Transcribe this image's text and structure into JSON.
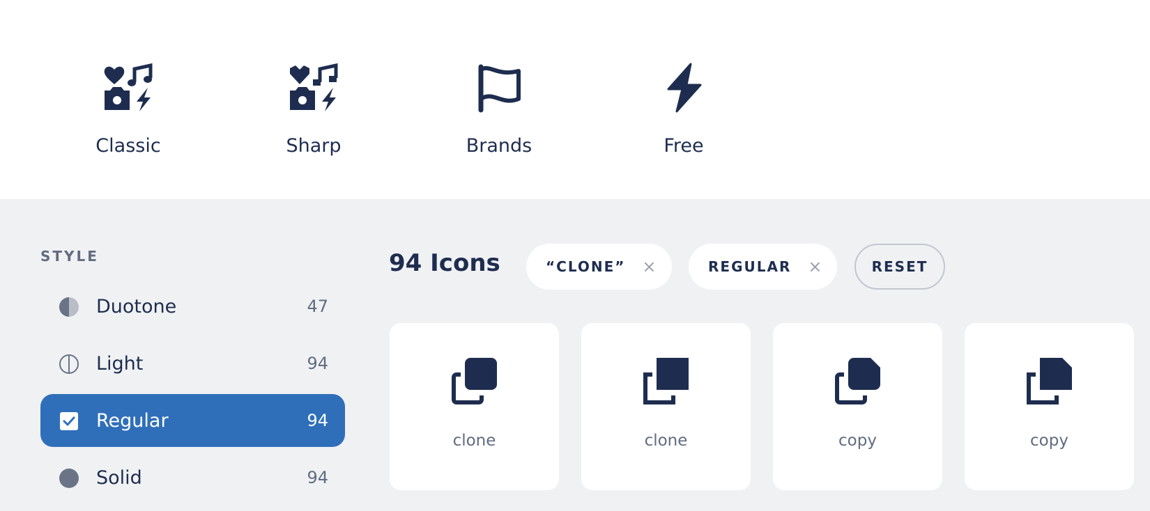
{
  "families": [
    {
      "label": "Classic",
      "icon": "heart-music-camera-bolt-icon"
    },
    {
      "label": "Sharp",
      "icon": "heart-music-camera-bolt-icon"
    },
    {
      "label": "Brands",
      "icon": "flag-icon"
    },
    {
      "label": "Free",
      "icon": "bolt-icon"
    }
  ],
  "sidebar": {
    "heading": "STYLE",
    "items": [
      {
        "label": "Duotone",
        "count": "47",
        "icon": "half-circle-icon"
      },
      {
        "label": "Light",
        "count": "94",
        "icon": "outline-half-circle-icon"
      },
      {
        "label": "Regular",
        "count": "94",
        "icon": "checkbox-checked-icon",
        "active": true
      },
      {
        "label": "Solid",
        "count": "94",
        "icon": "filled-circle-icon"
      }
    ]
  },
  "results": {
    "count_label": "94 Icons",
    "filters": [
      {
        "label": "“CLONE”",
        "remove": "×"
      },
      {
        "label": "REGULAR",
        "remove": "×"
      }
    ],
    "reset_label": "RESET",
    "icons": [
      {
        "name": "clone",
        "icon": "clone-rounded-icon"
      },
      {
        "name": "clone",
        "icon": "clone-sharp-icon"
      },
      {
        "name": "copy",
        "icon": "copy-rounded-icon"
      },
      {
        "name": "copy",
        "icon": "copy-sharp-icon"
      }
    ]
  },
  "colors": {
    "navy": "#1e2d4f",
    "accent": "#2f6fba",
    "muted": "#616c80",
    "background": "#f0f1f3"
  }
}
